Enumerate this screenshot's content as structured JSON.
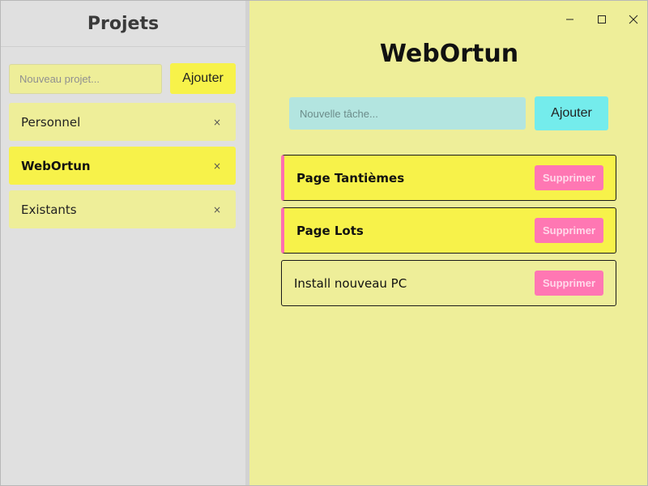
{
  "sidebar": {
    "title": "Projets",
    "new_project_placeholder": "Nouveau projet...",
    "add_label": "Ajouter",
    "projects": [
      {
        "label": "Personnel",
        "close": "×",
        "active": false
      },
      {
        "label": "WebOrtun",
        "close": "×",
        "active": true
      },
      {
        "label": "Existants",
        "close": "×",
        "active": false
      }
    ]
  },
  "window_controls": {
    "minimize_icon": "minimize-icon",
    "maximize_icon": "maximize-icon",
    "close_icon": "close-icon"
  },
  "main": {
    "title": "WebOrtun",
    "new_task_placeholder": "Nouvelle tâche...",
    "add_label": "Ajouter",
    "delete_label": "Supprimer",
    "tasks": [
      {
        "label": "Page Tantièmes",
        "highlighted": true
      },
      {
        "label": "Page Lots",
        "highlighted": true
      },
      {
        "label": "Install nouveau PC",
        "highlighted": false
      }
    ]
  },
  "colors": {
    "background": "#eeee99",
    "sidebar_bg": "#e0e0e0",
    "accent_yellow": "#f7f24a",
    "accent_pink": "#ff77b3",
    "task_input_bg": "#b3e5e0",
    "task_add_bg": "#74ecec"
  }
}
